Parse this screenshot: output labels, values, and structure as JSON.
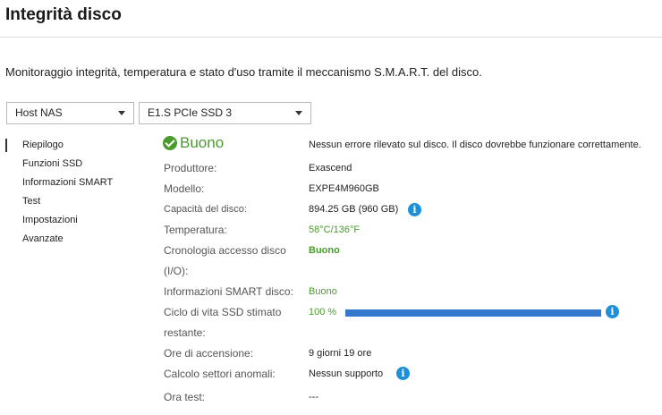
{
  "page": {
    "title": "Integrità disco",
    "description": "Monitoraggio integrità, temperatura e stato d'uso tramite il meccanismo S.M.A.R.T. del disco."
  },
  "selectors": {
    "host": "Host NAS",
    "disk": "E1.S PCIe SSD 3"
  },
  "nav": {
    "items": [
      "Riepilogo",
      "Funzioni SSD",
      "Informazioni SMART",
      "Test",
      "Impostazioni",
      "Avanzate"
    ],
    "active": "Riepilogo"
  },
  "summary": {
    "status": "Buono",
    "status_message": "Nessun errore rilevato sul disco. Il disco dovrebbe funzionare correttamente.",
    "manufacturer_label": "Produttore:",
    "manufacturer": "Exascend",
    "model_label": "Modello:",
    "model": "EXPE4M960GB",
    "capacity_label": "Capacità del disco:",
    "capacity": "894.25 GB (960 GB)",
    "temperature_label": "Temperatura:",
    "temperature": "58°C/136°F",
    "access_history_label_1": "Cronologia accesso disco",
    "access_history_label_2": "(I/O):",
    "access_history": "Buono",
    "smart_info_label": "Informazioni SMART disco:",
    "smart_info": "Buono",
    "life_label_1": "Ciclo di vita SSD stimato",
    "life_label_2": "restante:",
    "life_text": "100 %",
    "life_percent": 100,
    "power_on_label": "Ore di accensione:",
    "power_on": "9 giorni 19 ore",
    "bad_sector_label": "Calcolo settori anomali:",
    "bad_sector": "Nessun supporto",
    "test_time_label": "Ora test:",
    "test_time": "---"
  },
  "colors": {
    "good": "#4a9b2e",
    "info": "#1e90d9",
    "bar": "#3579cf"
  },
  "icons": {
    "status": "check-circle-icon",
    "info": "info-icon",
    "dropdown": "chevron-down-icon"
  }
}
